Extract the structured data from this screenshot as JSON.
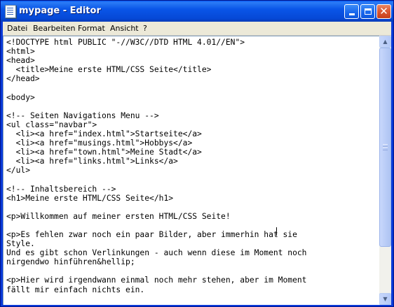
{
  "window": {
    "title": "mypage - Editor",
    "icon": "notepad-icon",
    "controls": {
      "minimize_icon": "minimize-icon",
      "maximize_icon": "maximize-icon",
      "close_icon": "close-icon",
      "close_glyph": "✕"
    }
  },
  "menu": {
    "items": [
      "Datei",
      "Bearbeiten",
      "Format",
      "Ansicht",
      "?"
    ]
  },
  "editor": {
    "lines": [
      "<!DOCTYPE html PUBLIC \"-//W3C//DTD HTML 4.01//EN\">",
      "<html>",
      "<head>",
      "  <title>Meine erste HTML/CSS Seite</title>",
      "</head>",
      "",
      "<body>",
      "",
      "<!-- Seiten Navigations Menu -->",
      "<ul class=\"navbar\">",
      "  <li><a href=\"index.html\">Startseite</a>",
      "  <li><a href=\"musings.html\">Hobbys</a>",
      "  <li><a href=\"town.html\">Meine Stadt</a>",
      "  <li><a href=\"links.html\">Links</a>",
      "</ul>",
      "",
      "<!-- Inhaltsbereich -->",
      "<h1>Meine erste HTML/CSS Seite</h1>",
      "",
      "<p>Willkommen auf meiner ersten HTML/CSS Seite!",
      "",
      "<p>Es fehlen zwar noch ein paar Bilder, aber immerhin hat sie",
      "Style.",
      "Und es gibt schon Verlinkungen - auch wenn diese im Moment noch",
      "nirgendwo hinführen&hellip;",
      "",
      "<p>Hier wird irgendwann einmal noch mehr stehen, aber im Moment",
      "fällt mir einfach nichts ein."
    ]
  },
  "scrollbar": {
    "up_icon": "scroll-up-arrow-icon",
    "down_icon": "scroll-down-arrow-icon",
    "up_glyph": "▲",
    "down_glyph": "▼",
    "position_fraction": 0.0
  },
  "colors": {
    "titlebar": "#0a56e8",
    "menubar": "#ece9d8",
    "editor_bg": "#ffffff",
    "close_button": "#dc5a36"
  }
}
